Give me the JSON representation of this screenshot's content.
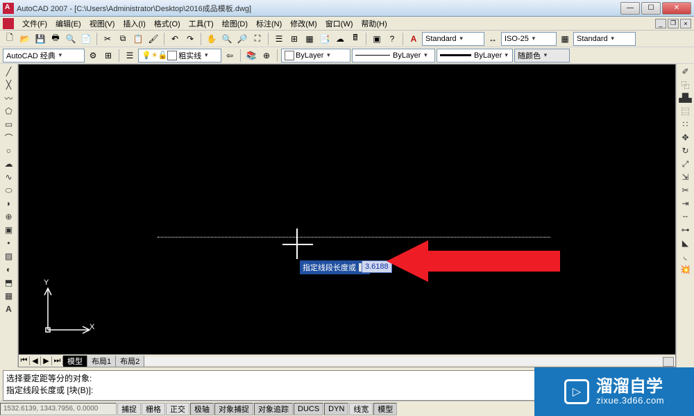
{
  "title": "AutoCAD 2007 - [C:\\Users\\Administrator\\Desktop\\2016成品模板.dwg]",
  "menu": [
    "文件(F)",
    "编辑(E)",
    "视图(V)",
    "插入(I)",
    "格式(O)",
    "工具(T)",
    "绘图(D)",
    "标注(N)",
    "修改(M)",
    "窗口(W)",
    "帮助(H)"
  ],
  "toolbar1": {
    "text_style": "Standard",
    "dim_style": "ISO-25",
    "table_style": "Standard"
  },
  "workspace": {
    "name": "AutoCAD 经典",
    "layer_label": "粗实线"
  },
  "properties": {
    "color_label": "ByLayer",
    "linetype_label": "ByLayer",
    "lineweight_label": "ByLayer",
    "plotstyle_label": "随颜色"
  },
  "canvas": {
    "prompt_label": "指定线段长度或",
    "prompt_value": "3.6188"
  },
  "ucs": {
    "x": "X",
    "y": "Y"
  },
  "tabs": [
    "模型",
    "布局1",
    "布局2"
  ],
  "command": {
    "line1": "选择要定距等分的对象:",
    "line2": "指定线段长度或 [块(B)]:"
  },
  "status": {
    "coords": "1532.6139, 1343.7956, 0.0000",
    "buttons": [
      "捕捉",
      "栅格",
      "正交",
      "极轴",
      "对象捕捉",
      "对象追踪",
      "DUCS",
      "DYN",
      "线宽",
      "模型"
    ]
  },
  "watermark": {
    "brand": "溜溜自学",
    "url": "zixue.3d66.com"
  }
}
